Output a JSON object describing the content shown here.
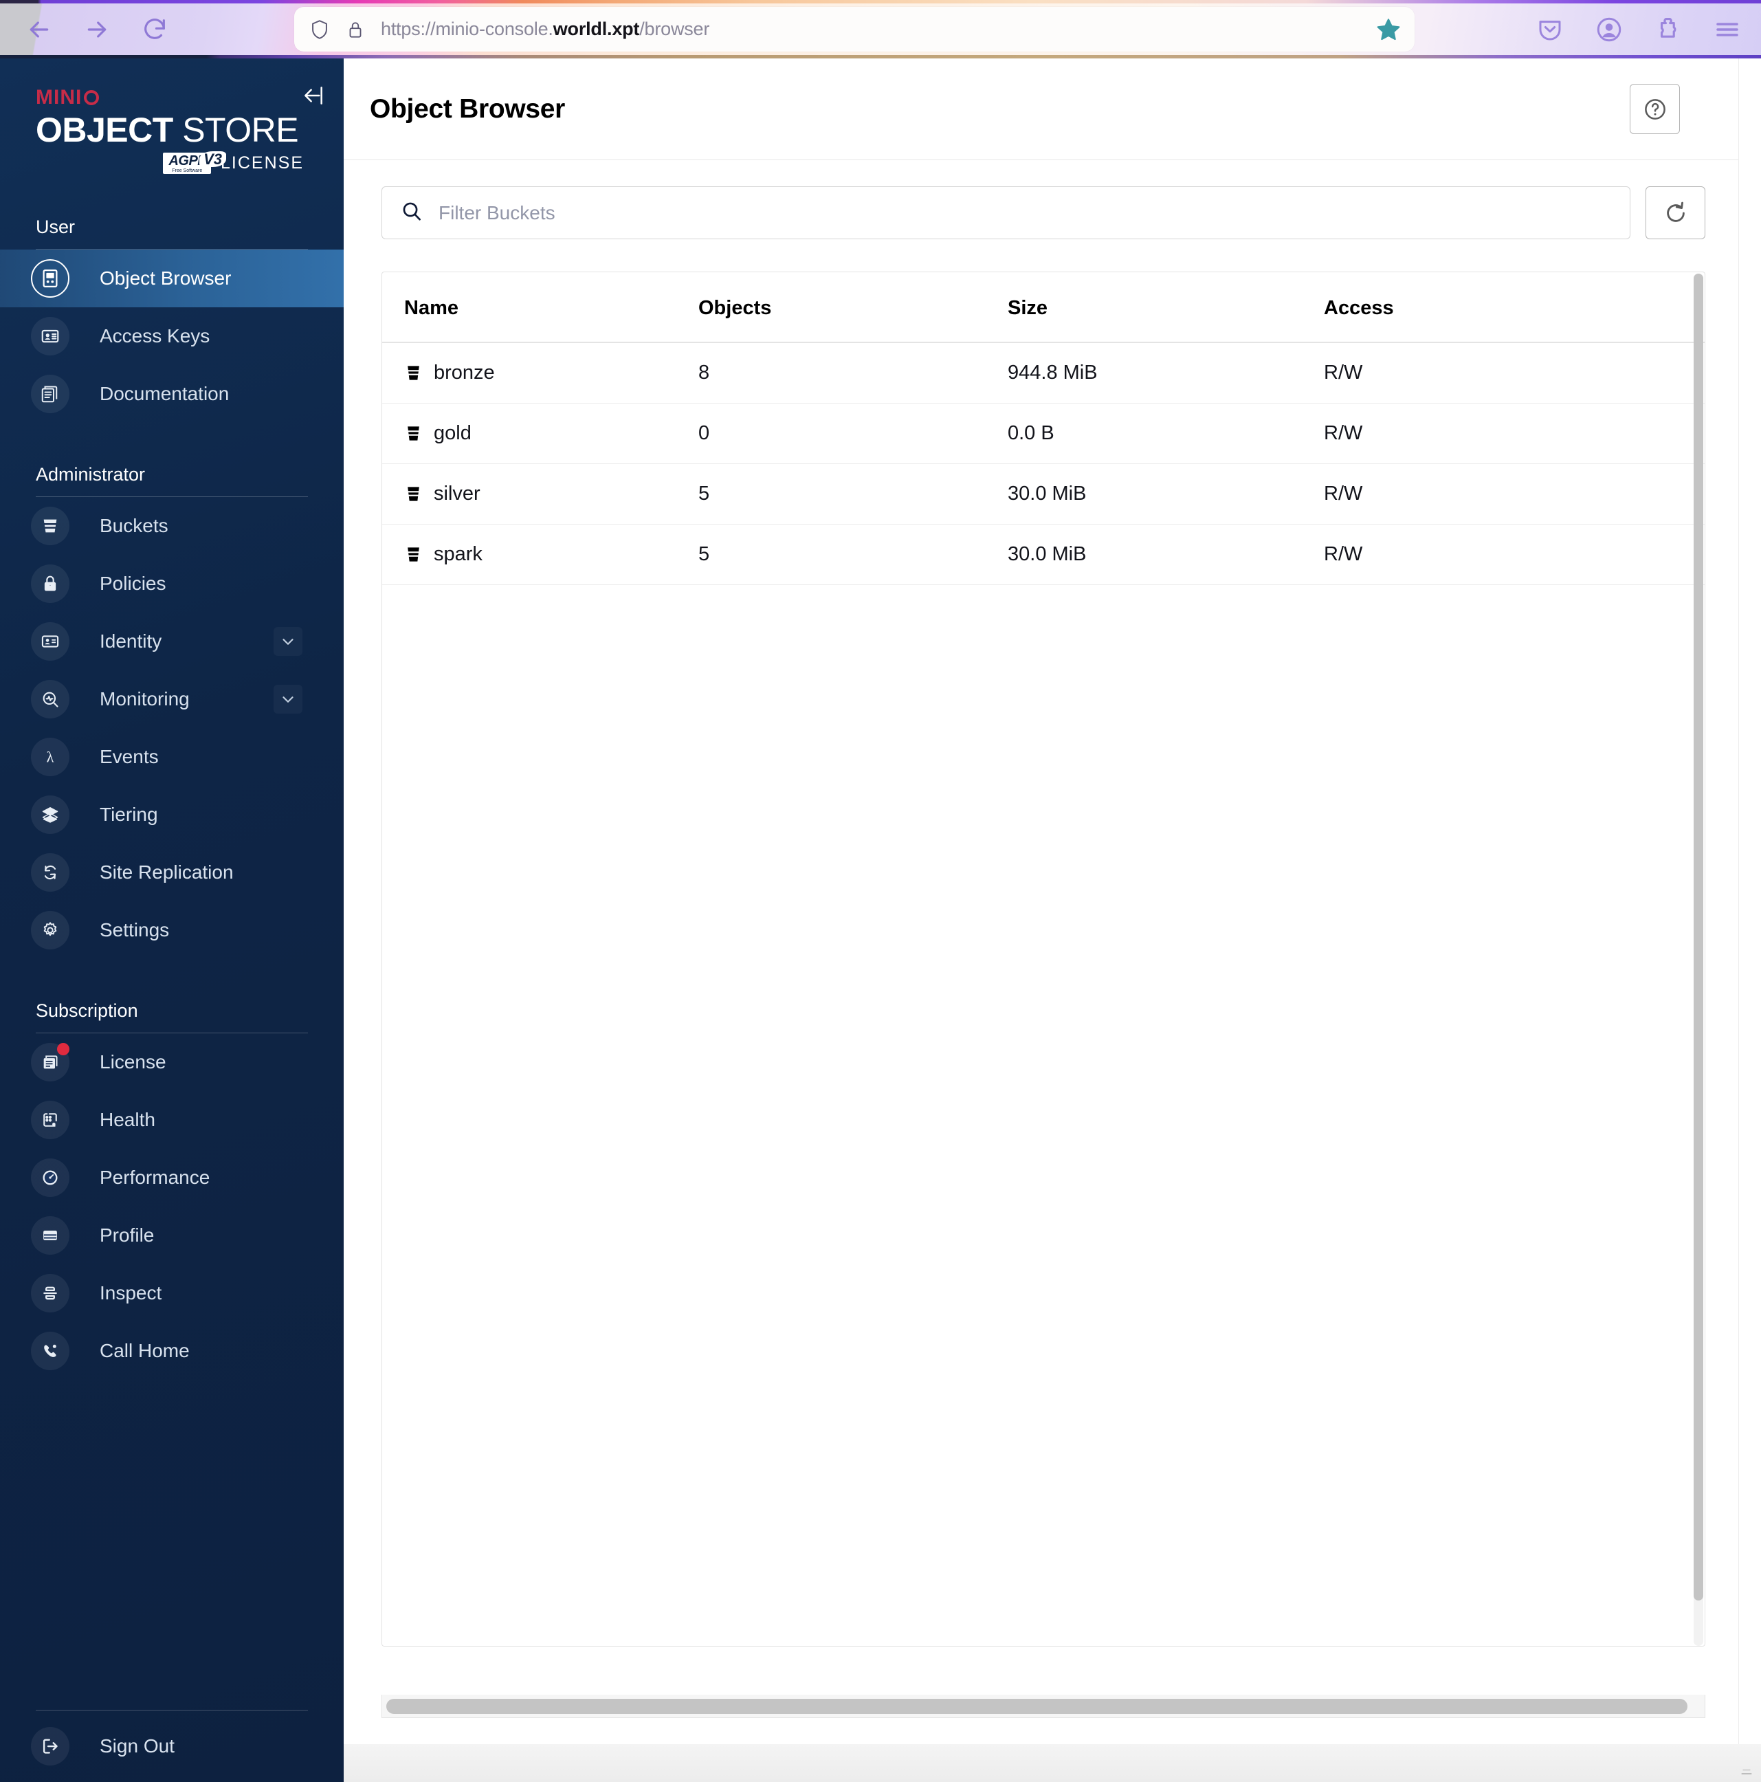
{
  "browser": {
    "url_prefix": "https://minio-console.",
    "url_host": "worldl.xpt",
    "url_path": "/browser",
    "back_label": "Back",
    "forward_label": "Forward",
    "reload_label": "Reload",
    "shield_label": "Tracking Protection",
    "lock_label": "Connection Secure",
    "bookmark_label": "Bookmark this page",
    "pocket_label": "Save to Pocket",
    "account_label": "Account",
    "extensions_label": "Extensions",
    "menu_label": "Open application menu"
  },
  "sidebar": {
    "logo": {
      "brand": "MINI",
      "brand_o": "O",
      "product_bold": "OBJECT",
      "product_light": " STORE",
      "agpl_main": "AGPL",
      "agpl_sub": "Free Software",
      "agpl_v3": "V3",
      "license_word": "LICENSE"
    },
    "collapse_label": "Collapse sidebar",
    "sections": [
      {
        "label": "User",
        "items": [
          {
            "label": "Object Browser",
            "icon": "object-browser-icon",
            "active": true
          },
          {
            "label": "Access Keys",
            "icon": "access-keys-icon",
            "active": false
          },
          {
            "label": "Documentation",
            "icon": "documentation-icon",
            "active": false
          }
        ]
      },
      {
        "label": "Administrator",
        "items": [
          {
            "label": "Buckets",
            "icon": "bucket-icon",
            "active": false
          },
          {
            "label": "Policies",
            "icon": "lock-icon",
            "active": false
          },
          {
            "label": "Identity",
            "icon": "identity-icon",
            "active": false,
            "chevron": true
          },
          {
            "label": "Monitoring",
            "icon": "monitoring-icon",
            "active": false,
            "chevron": true
          },
          {
            "label": "Events",
            "icon": "lambda-icon",
            "active": false
          },
          {
            "label": "Tiering",
            "icon": "layers-icon",
            "active": false
          },
          {
            "label": "Site Replication",
            "icon": "sync-icon",
            "active": false
          },
          {
            "label": "Settings",
            "icon": "gear-icon",
            "active": false
          }
        ]
      },
      {
        "label": "Subscription",
        "items": [
          {
            "label": "License",
            "icon": "license-icon",
            "active": false,
            "badge": true
          },
          {
            "label": "Health",
            "icon": "health-icon",
            "active": false
          },
          {
            "label": "Performance",
            "icon": "speedometer-icon",
            "active": false
          },
          {
            "label": "Profile",
            "icon": "profile-icon",
            "active": false
          },
          {
            "label": "Inspect",
            "icon": "inspect-icon",
            "active": false
          },
          {
            "label": "Call Home",
            "icon": "phone-icon",
            "active": false
          }
        ]
      }
    ],
    "sign_out": {
      "label": "Sign Out",
      "icon": "sign-out-icon"
    }
  },
  "header": {
    "title": "Object Browser",
    "help_label": "Help"
  },
  "toolbar": {
    "filter_placeholder": "Filter Buckets",
    "filter_value": "",
    "search_icon": "search-icon",
    "refresh_label": "Refresh",
    "refresh_icon": "refresh-icon"
  },
  "table": {
    "columns": [
      "Name",
      "Objects",
      "Size",
      "Access"
    ],
    "rows": [
      {
        "name": "bronze",
        "objects": "8",
        "size": "944.8 MiB",
        "access": "R/W"
      },
      {
        "name": "gold",
        "objects": "0",
        "size": "0.0 B",
        "access": "R/W"
      },
      {
        "name": "silver",
        "objects": "5",
        "size": "30.0 MiB",
        "access": "R/W"
      },
      {
        "name": "spark",
        "objects": "5",
        "size": "30.0 MiB",
        "access": "R/W"
      }
    ]
  },
  "colors": {
    "sidebar_bg": "#0e2546",
    "sidebar_active": "#306ca4",
    "brand_red": "#c72c48",
    "badge_red": "#e02b3f",
    "bookmark_teal": "#3a9aa4",
    "chrome_purple": "#8f79d6"
  }
}
